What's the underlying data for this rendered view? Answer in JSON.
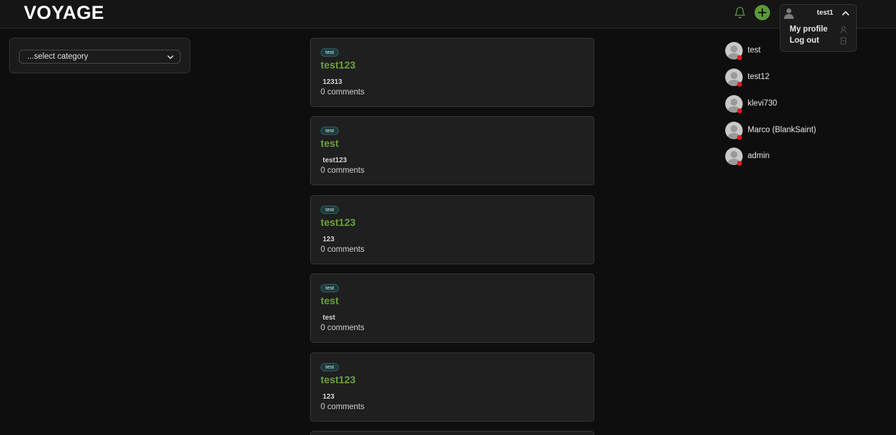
{
  "header": {
    "logo": "VOYAGE",
    "icons": {
      "notifications": "bell-icon",
      "create": "plus-icon"
    },
    "accent_color": "#5a9a3a"
  },
  "user_menu": {
    "username": "test1",
    "items": [
      {
        "label": "My profile",
        "icon": "user-icon"
      },
      {
        "label": "Log out",
        "icon": "logout-icon"
      }
    ]
  },
  "filter": {
    "placeholder": "...select category"
  },
  "posts": [
    {
      "tag": "test",
      "title": "test123",
      "body": "12313",
      "comments": "0 comments"
    },
    {
      "tag": "test",
      "title": "test",
      "body": "test123",
      "comments": "0 comments"
    },
    {
      "tag": "test",
      "title": "test123",
      "body": "123",
      "comments": "0 comments"
    },
    {
      "tag": "test",
      "title": "test",
      "body": "test",
      "comments": "0 comments"
    },
    {
      "tag": "test",
      "title": "test123",
      "body": "123",
      "comments": "0 comments"
    }
  ],
  "users": [
    {
      "name": "test",
      "status": "offline"
    },
    {
      "name": "test12",
      "status": "offline"
    },
    {
      "name": "klevi730",
      "status": "offline"
    },
    {
      "name": "Marco (BlankSaint)",
      "status": "offline"
    },
    {
      "name": "admin",
      "status": "offline"
    }
  ],
  "colors": {
    "post_title": "#6a9f3c",
    "status_offline": "#e01b1b"
  }
}
